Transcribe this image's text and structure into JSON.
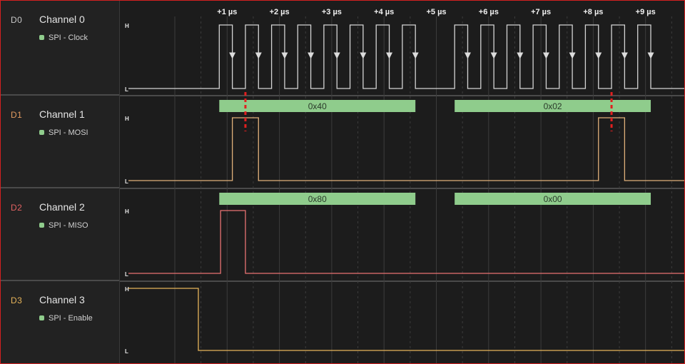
{
  "colors": {
    "background": "#1c1c1c",
    "sidebar": "#222222",
    "divider": "#4a4a4a",
    "grid": "#3c3c3c",
    "frame": "#d42020",
    "decode_bar": "#8fcc8c",
    "cursor": "#e02020"
  },
  "time_ruler": {
    "ticks": [
      "+1 µs",
      "+2 µs",
      "+3 µs",
      "+4 µs",
      "+5 µs",
      "+6 µs",
      "+7 µs",
      "+8 µs",
      "+9 µs"
    ]
  },
  "channels": [
    {
      "id": "D0",
      "name": "Channel 0",
      "analyzer": "SPI - Clock",
      "id_color": "#c8c8c8",
      "wave_color": "#d4d4d4",
      "analyzer_color": "#8fcc8c",
      "high_label": "H",
      "low_label": "L",
      "edges_us": [
        0.85,
        1.1,
        1.35,
        1.6,
        1.85,
        2.1,
        2.35,
        2.6,
        2.85,
        3.1,
        3.35,
        3.6,
        3.85,
        4.1,
        4.35,
        4.6,
        5.35,
        5.6,
        5.85,
        6.1,
        6.35,
        6.6,
        6.85,
        7.1,
        7.35,
        7.6,
        7.85,
        8.1,
        8.35,
        8.6,
        8.85,
        9.1
      ],
      "initial_level": 0,
      "falling_arrows": true,
      "decodes": []
    },
    {
      "id": "D1",
      "name": "Channel 1",
      "analyzer": "SPI - MOSI",
      "id_color": "#e09a60",
      "wave_color": "#e0b07a",
      "analyzer_color": "#8fcc8c",
      "high_label": "H",
      "low_label": "L",
      "edges_us": [
        1.1,
        1.6,
        8.1,
        8.6
      ],
      "initial_level": 0,
      "falling_arrows": false,
      "decodes": [
        {
          "label": "0x40",
          "start_us": 0.85,
          "end_us": 4.6
        },
        {
          "label": "0x02",
          "start_us": 5.35,
          "end_us": 9.1
        }
      ]
    },
    {
      "id": "D2",
      "name": "Channel 2",
      "analyzer": "SPI - MISO",
      "id_color": "#e06262",
      "wave_color": "#e87272",
      "analyzer_color": "#8fcc8c",
      "high_label": "H",
      "low_label": "L",
      "edges_us": [
        0.875,
        1.35
      ],
      "initial_level": 0,
      "falling_arrows": false,
      "decodes": [
        {
          "label": "0x80",
          "start_us": 0.85,
          "end_us": 4.6
        },
        {
          "label": "0x00",
          "start_us": 5.35,
          "end_us": 9.1
        }
      ]
    },
    {
      "id": "D3",
      "name": "Channel 3",
      "analyzer": "SPI - Enable",
      "id_color": "#e6b45a",
      "wave_color": "#e6b45a",
      "analyzer_color": "#8fcc8c",
      "high_label": "H",
      "low_label": "L",
      "edges_us": [
        0.45,
        10.0
      ],
      "initial_level": 1,
      "falling_arrows": false,
      "decodes": []
    }
  ],
  "cursors_us": [
    1.35,
    8.35
  ]
}
